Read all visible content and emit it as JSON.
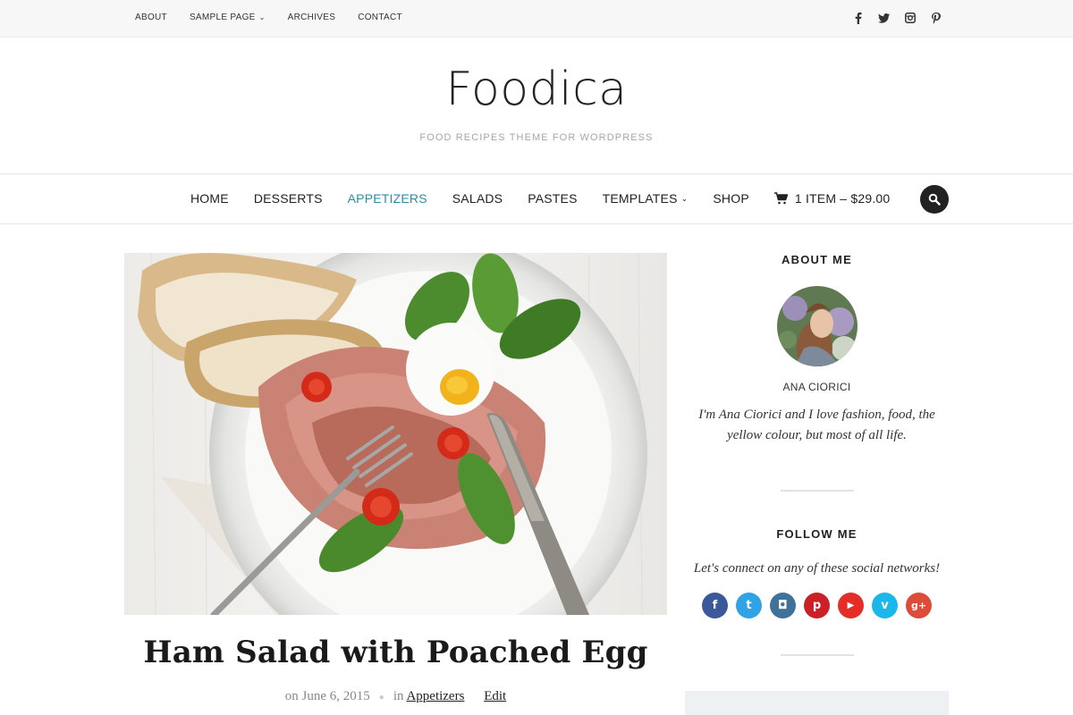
{
  "topbar": {
    "links": [
      {
        "label": "ABOUT"
      },
      {
        "label": "SAMPLE PAGE",
        "dropdown": true
      },
      {
        "label": "ARCHIVES"
      },
      {
        "label": "CONTACT"
      }
    ],
    "social_icons": [
      "facebook-icon",
      "twitter-icon",
      "instagram-icon",
      "pinterest-icon"
    ]
  },
  "header": {
    "logo": "Foodica",
    "tagline": "FOOD RECIPES THEME FOR WORDPRESS"
  },
  "nav": {
    "items": [
      {
        "label": "HOME"
      },
      {
        "label": "DESSERTS"
      },
      {
        "label": "APPETIZERS",
        "active": true
      },
      {
        "label": "SALADS"
      },
      {
        "label": "PASTES"
      },
      {
        "label": "TEMPLATES",
        "dropdown": true
      },
      {
        "label": "SHOP"
      }
    ],
    "cart_label": "1 ITEM – $29.00",
    "accent_color": "#2a8fa5"
  },
  "post": {
    "title": "Ham Salad with Poached Egg",
    "meta_on": "on June 6, 2015",
    "meta_in": "in",
    "category": "Appetizers",
    "edit": "Edit"
  },
  "sidebar": {
    "about_title": "ABOUT ME",
    "author_name": "ANA CIORICI",
    "bio": "I'm Ana Ciorici and I love fashion, food, the yellow colour, but most of all life.",
    "follow_title": "FOLLOW ME",
    "follow_text": "Let's connect on any of these social networks!",
    "social": [
      {
        "name": "facebook-icon",
        "glyph": "f",
        "color": "#3b5998"
      },
      {
        "name": "twitter-icon",
        "glyph": "t",
        "color": "#2fa3e6"
      },
      {
        "name": "instagram-icon",
        "glyph": "◘",
        "color": "#3f729b"
      },
      {
        "name": "pinterest-icon",
        "glyph": "p",
        "color": "#cb2027"
      },
      {
        "name": "youtube-icon",
        "glyph": "▶",
        "color": "#e52d27"
      },
      {
        "name": "vimeo-icon",
        "glyph": "v",
        "color": "#1ab7ea"
      },
      {
        "name": "googleplus-icon",
        "glyph": "g+",
        "color": "#dd4b39"
      }
    ]
  }
}
